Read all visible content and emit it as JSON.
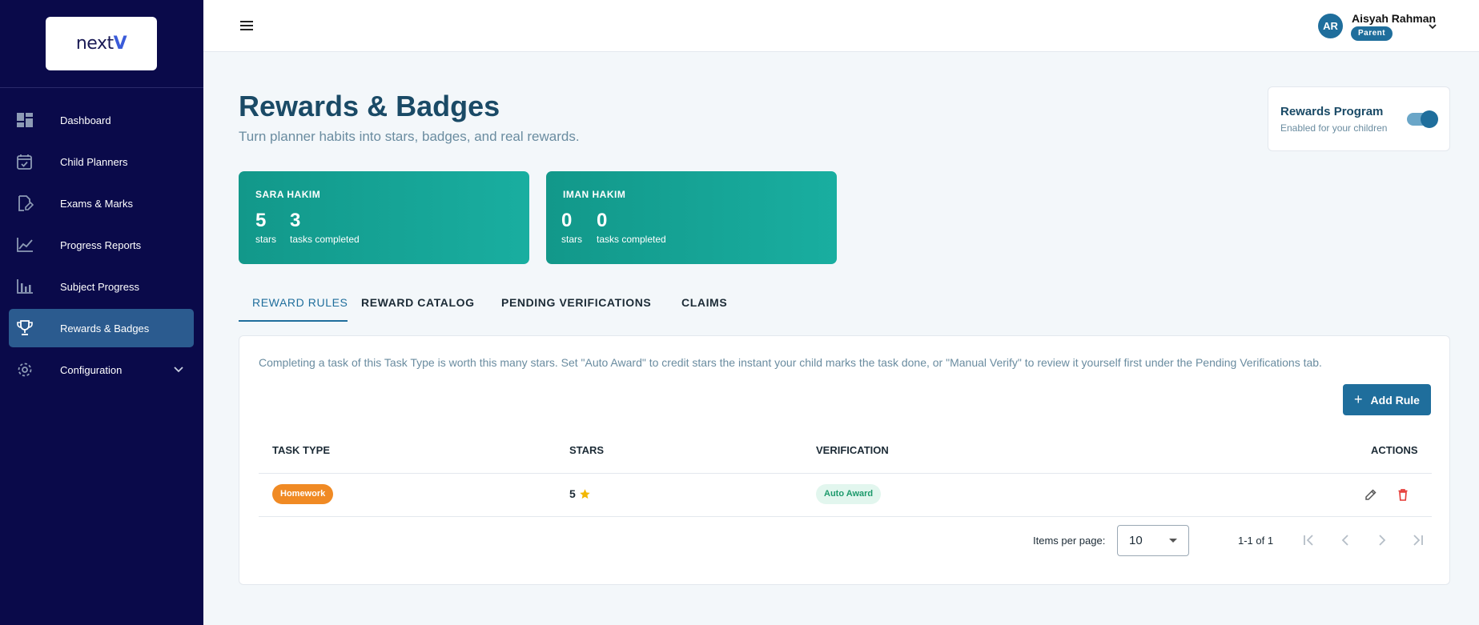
{
  "app": {
    "logo": "next",
    "logo_accent": "V"
  },
  "sidebar": {
    "items": [
      {
        "label": "Dashboard",
        "icon": "dashboard-icon"
      },
      {
        "label": "Child Planners",
        "icon": "calendar-check-icon"
      },
      {
        "label": "Exams & Marks",
        "icon": "document-edit-icon"
      },
      {
        "label": "Progress Reports",
        "icon": "line-chart-icon"
      },
      {
        "label": "Subject Progress",
        "icon": "bar-chart-icon"
      },
      {
        "label": "Rewards & Badges",
        "icon": "trophy-icon",
        "active": true
      },
      {
        "label": "Configuration",
        "icon": "gear-icon",
        "expandable": true
      }
    ]
  },
  "topbar": {
    "menu_icon": "hamburger-icon",
    "user": {
      "initials": "AR",
      "name": "Aisyah Rahman",
      "role": "Parent"
    }
  },
  "page": {
    "title": "Rewards & Badges",
    "subtitle": "Turn planner habits into stars, badges, and real rewards."
  },
  "program": {
    "title": "Rewards Program",
    "subtitle": "Enabled for your children",
    "enabled": true
  },
  "children": [
    {
      "name": "SARA HAKIM",
      "stars": "5",
      "stars_label": "stars",
      "tasks": "3",
      "tasks_label": "tasks completed"
    },
    {
      "name": "IMAN HAKIM",
      "stars": "0",
      "stars_label": "stars",
      "tasks": "0",
      "tasks_label": "tasks completed"
    }
  ],
  "tabs": [
    {
      "label": "REWARD RULES",
      "active": true
    },
    {
      "label": "REWARD CATALOG"
    },
    {
      "label": "PENDING VERIFICATIONS"
    },
    {
      "label": "CLAIMS"
    }
  ],
  "rules": {
    "description": "Completing a task of this Task Type is worth this many stars. Set \"Auto Award\" to credit stars the instant your child marks the task done, or \"Manual Verify\" to review it yourself first under the Pending Verifications tab.",
    "add_label": "Add Rule",
    "columns": [
      "TASK TYPE",
      "STARS",
      "VERIFICATION",
      "ACTIONS"
    ],
    "rows": [
      {
        "task_type": "Homework",
        "stars": "5",
        "verification": "Auto Award"
      }
    ],
    "pagination": {
      "items_per_page_label": "Items per page:",
      "items_per_page": "10",
      "range": "1-1 of 1"
    }
  },
  "colors": {
    "sidebar_bg": "#0a0a4a",
    "primary": "#1f6e9c",
    "teal_card": "#12988a",
    "homework_pill": "#f08a24",
    "auto_award_text": "#1d9a6c",
    "delete": "#e53935",
    "star": "#f2b705"
  }
}
